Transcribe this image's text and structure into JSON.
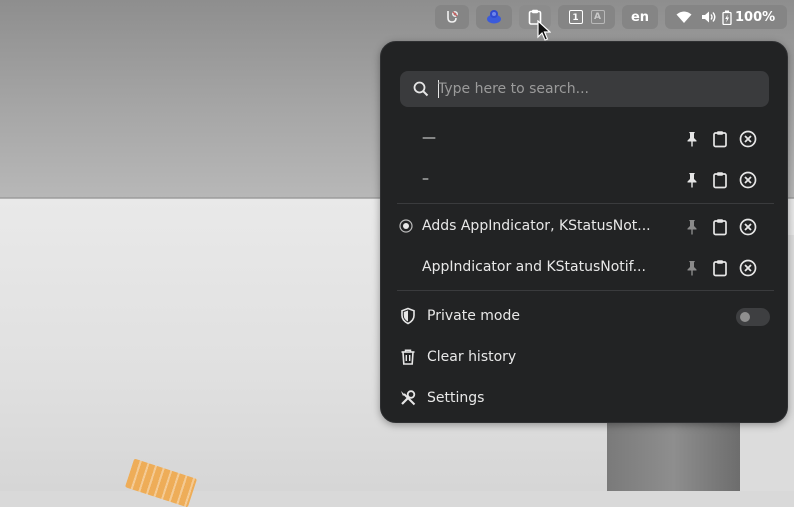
{
  "topbar": {
    "tray_items": [
      {
        "name": "accessibility-icon"
      },
      {
        "name": "notification-icon"
      },
      {
        "name": "clipboard-icon"
      },
      {
        "name": "workspace-1-icon"
      },
      {
        "name": "workspace-2-icon"
      }
    ],
    "workspace_1_label": "1",
    "workspace_2_label": "A",
    "language": "en",
    "battery_percent": "100%",
    "status_icons": [
      "wifi-icon",
      "volume-icon",
      "battery-icon"
    ]
  },
  "clipboard_menu": {
    "search": {
      "placeholder": "Type here to search...",
      "value": ""
    },
    "pinned_items": [
      {
        "text": "—",
        "pinned": true
      },
      {
        "text": "–",
        "pinned": true
      }
    ],
    "history_items": [
      {
        "text": "Adds AppIndicator, KStatusNot...",
        "selected": true,
        "pinned": false
      },
      {
        "text": "AppIndicator and KStatusNotif...",
        "selected": false,
        "pinned": false
      }
    ],
    "actions": {
      "private_mode_label": "Private mode",
      "private_mode_enabled": false,
      "clear_history_label": "Clear history",
      "settings_label": "Settings"
    }
  },
  "colors": {
    "popup_bg": "#222324",
    "search_bg": "#3a3b3d",
    "text": "#e8e8e8",
    "topbar_pill": "#858585",
    "notification_accent": "#3b5bdb"
  }
}
